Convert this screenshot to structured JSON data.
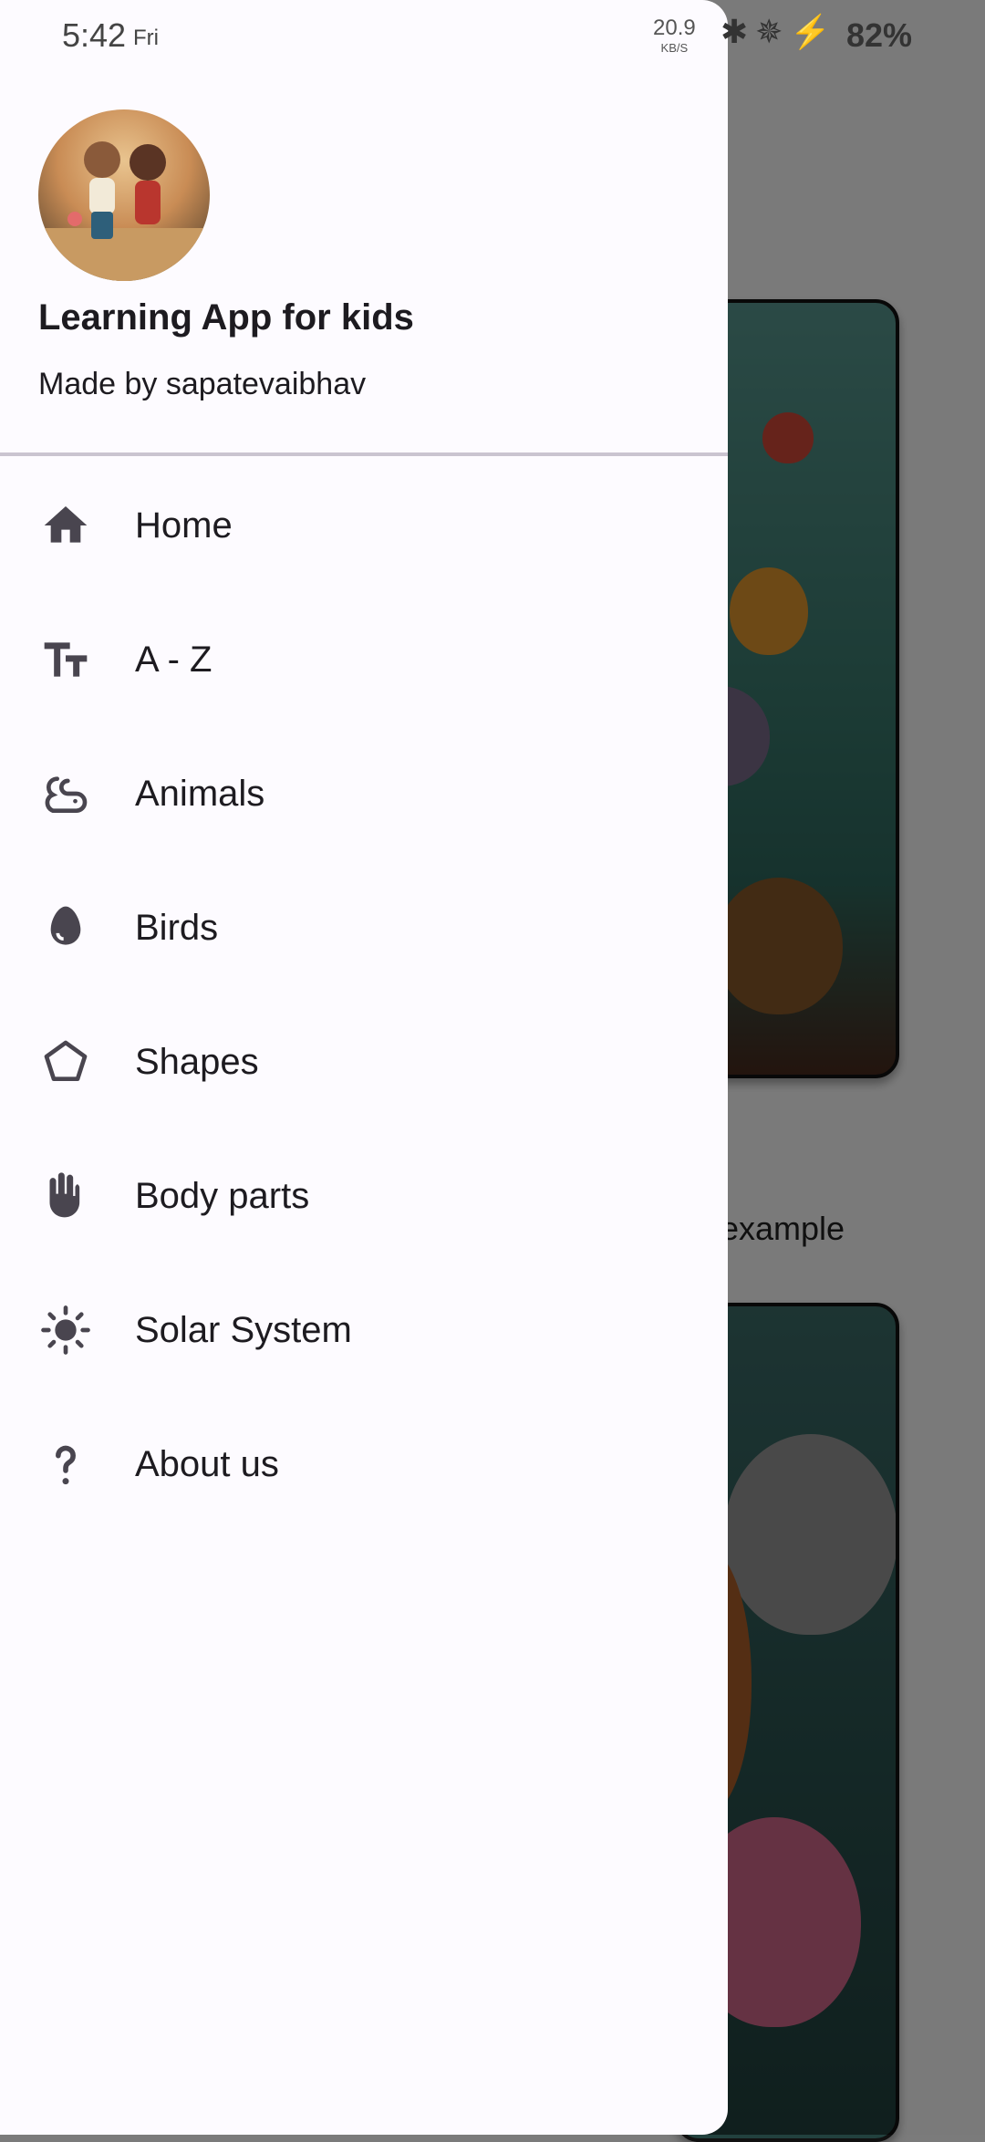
{
  "status_bar": {
    "time": "5:42",
    "day": "Fri",
    "net_speed": "20.9",
    "net_unit": "KB/S",
    "battery": "82%"
  },
  "drawer": {
    "header": {
      "title": "Learning App for kids",
      "subtitle": "Made by sapatevaibhav"
    },
    "items": [
      {
        "label": "Home",
        "icon": "home-icon"
      },
      {
        "label": "A - Z",
        "icon": "text-size-icon"
      },
      {
        "label": "Animals",
        "icon": "rat-icon"
      },
      {
        "label": "Birds",
        "icon": "egg-icon"
      },
      {
        "label": "Shapes",
        "icon": "pentagon-icon"
      },
      {
        "label": "Body parts",
        "icon": "hand-icon"
      },
      {
        "label": "Solar System",
        "icon": "sun-icon"
      },
      {
        "label": "About us",
        "icon": "question-icon"
      }
    ]
  },
  "background": {
    "visible_text": "example"
  },
  "colors": {
    "drawer_bg": "#fdfbff",
    "text": "#1d1b20",
    "icon": "#49454f",
    "divider": "#cac4d0"
  }
}
